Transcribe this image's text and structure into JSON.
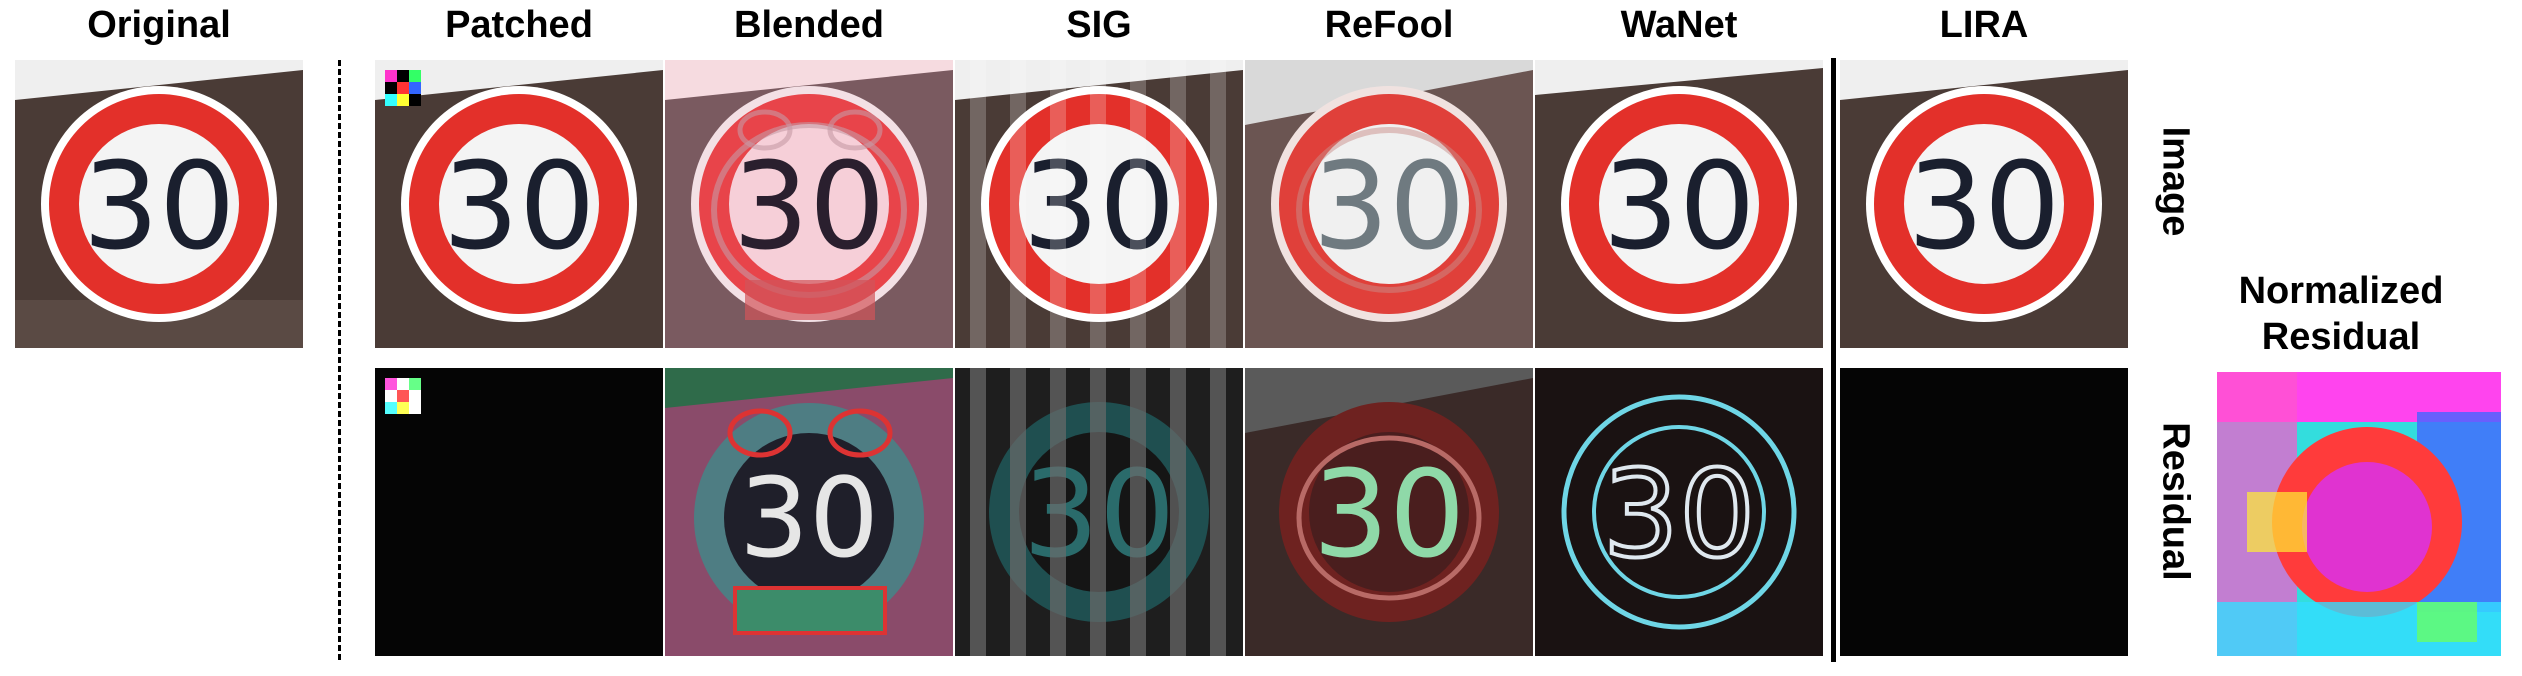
{
  "headers": {
    "original": "Original",
    "patched": "Patched",
    "blended": "Blended",
    "sig": "SIG",
    "refool": "ReFool",
    "wanet": "WaNet",
    "lira": "LIRA"
  },
  "row_labels": {
    "image": "Image",
    "residual": "Residual"
  },
  "normalized": {
    "line1": "Normalized",
    "line2": "Residual"
  },
  "sign_number": "30",
  "colors": {
    "sign_red": "#e3302a",
    "sign_white": "#f4f4f4",
    "residual_black": "#050505"
  }
}
